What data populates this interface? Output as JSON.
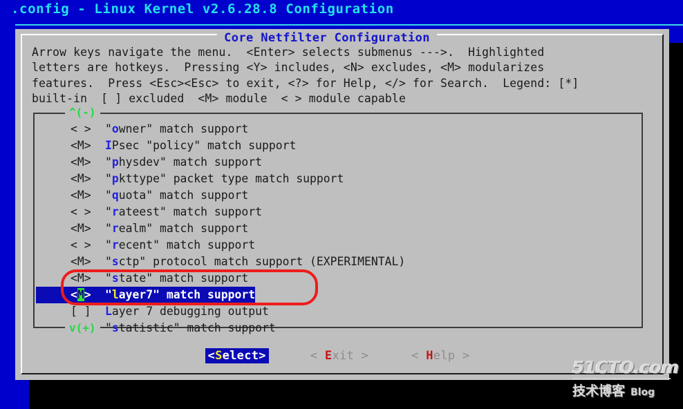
{
  "window": {
    "title": ".config - Linux Kernel v2.6.28.8 Configuration",
    "background_color": "#0000cc",
    "title_color": "#22e3f0"
  },
  "dialog": {
    "heading": "Core Netfilter Configuration",
    "heading_color": "#1414cc",
    "background_color": "#bfbfbf",
    "help_text": "Arrow keys navigate the menu.  <Enter> selects submenus --->.  Highlighted\nletters are hotkeys.  Pressing <Y> includes, <N> excludes, <M> modularizes\nfeatures.  Press <Esc><Esc> to exit, <?> for Help, </> for Search.  Legend: [*]\nbuilt-in  [ ] excluded  <M> module  < > module capable"
  },
  "list": {
    "scroll_up_marker": "^(-)",
    "scroll_down_marker": "v(+)",
    "scroll_marker_color": "#22d845",
    "selected_index": 10,
    "items": [
      {
        "tag": "< >",
        "hot": "o",
        "pre": "\"",
        "post": "wner\" match support"
      },
      {
        "tag": "<M>",
        "hot": "I",
        "pre": "",
        "post": "Psec \"policy\" match support"
      },
      {
        "tag": "<M>",
        "hot": "p",
        "pre": "\"",
        "post": "hysdev\" match support"
      },
      {
        "tag": "<M>",
        "hot": "p",
        "pre": "\"",
        "post": "kttype\" packet type match support"
      },
      {
        "tag": "<M>",
        "hot": "q",
        "pre": "\"",
        "post": "uota\" match support"
      },
      {
        "tag": "< >",
        "hot": "r",
        "pre": "\"",
        "post": "ateest\" match support"
      },
      {
        "tag": "<M>",
        "hot": "r",
        "pre": "\"",
        "post": "ealm\" match support"
      },
      {
        "tag": "< >",
        "hot": "r",
        "pre": "\"",
        "post": "ecent\" match support"
      },
      {
        "tag": "<M>",
        "hot": "s",
        "pre": "\"",
        "post": "ctp\" protocol match support (EXPERIMENTAL)"
      },
      {
        "tag": "<M>",
        "hot": "s",
        "pre": "\"",
        "post": "tate\" match support"
      },
      {
        "tag": "<M>",
        "hot": "l",
        "pre": "\"",
        "post": "ayer7\" match support",
        "selected": true,
        "cursor_char": "M"
      },
      {
        "tag": "[ ]",
        "hot": "L",
        "pre": "",
        "post": "ayer 7 debugging output"
      },
      {
        "tag": "<M>",
        "hot": "s",
        "pre": "\"",
        "post": "tatistic\" match support"
      }
    ]
  },
  "buttons": [
    {
      "name": "select",
      "left": "<",
      "hot": "S",
      "rest": "elect",
      "right": ">",
      "active": true
    },
    {
      "name": "exit",
      "left": "< ",
      "hot": "E",
      "rest": "xit",
      "right": " >",
      "active": false
    },
    {
      "name": "help",
      "left": "< ",
      "hot": "H",
      "rest": "elp",
      "right": " >",
      "active": false
    }
  ],
  "annotation": {
    "shape": "rounded-rectangle",
    "color": "#ee1c1c",
    "targets": [
      "\"layer7\" match support",
      "Layer 7 debugging output"
    ]
  },
  "watermark": {
    "top": "51CTO.com",
    "bottom_cn": "技术博客",
    "bottom_en": "Blog"
  }
}
